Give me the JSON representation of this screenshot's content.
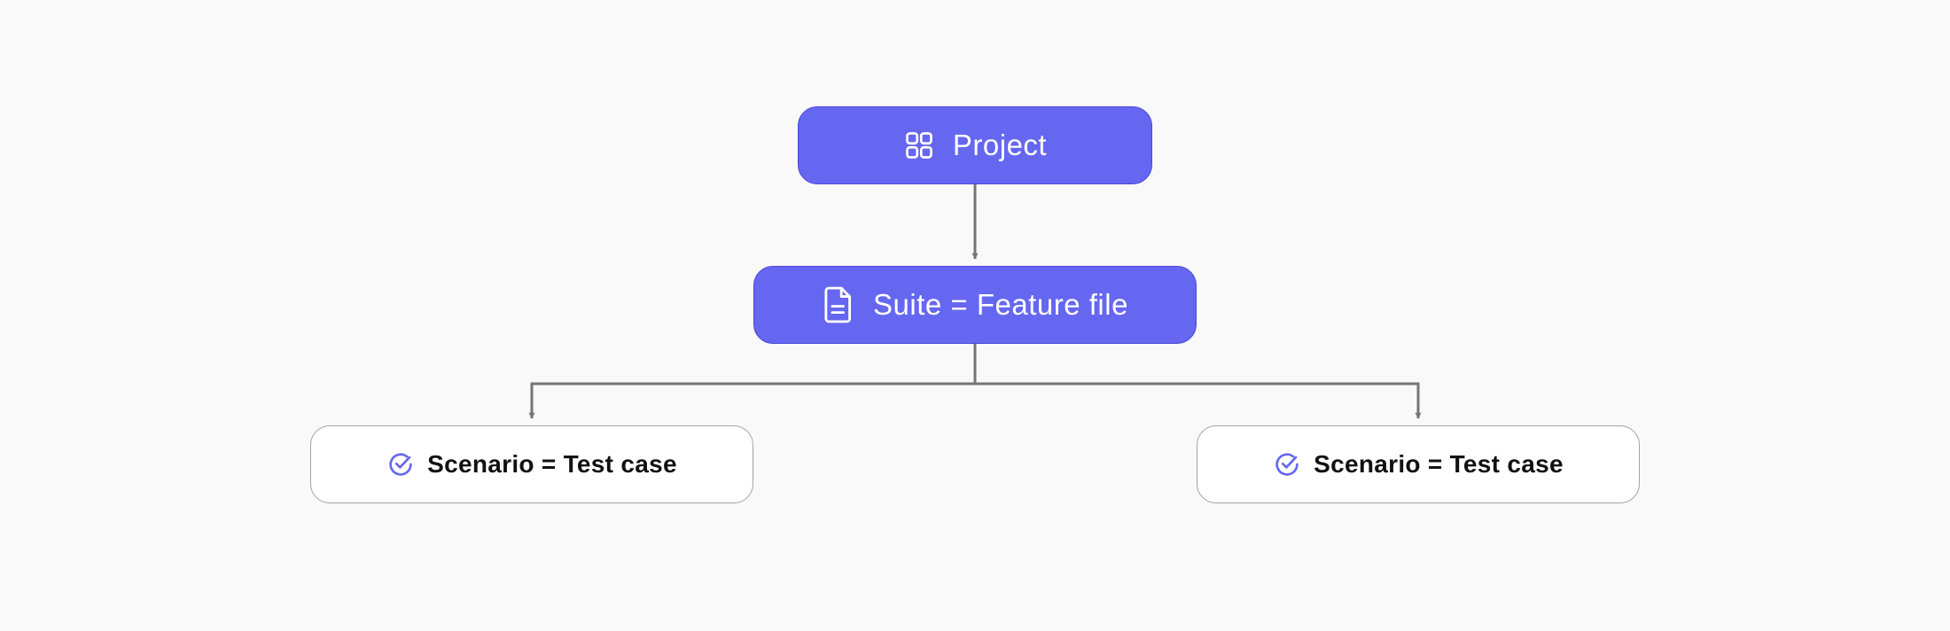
{
  "diagram": {
    "colors": {
      "background": "#f9f9f9",
      "primary_fill": "#6667f1",
      "primary_border": "#4b47d6",
      "secondary_fill": "#ffffff",
      "secondary_border": "#a3a3a3",
      "connector": "#757575",
      "check_icon": "#6667f1"
    },
    "nodes": [
      {
        "id": "project",
        "label": "Project",
        "icon": "grid-icon",
        "style": "primary"
      },
      {
        "id": "suite",
        "label": "Suite = Feature file",
        "icon": "document-icon",
        "style": "primary"
      },
      {
        "id": "scenario-1",
        "label": "Scenario = Test case",
        "icon": "check-circle-icon",
        "style": "secondary"
      },
      {
        "id": "scenario-2",
        "label": "Scenario = Test case",
        "icon": "check-circle-icon",
        "style": "secondary"
      }
    ],
    "edges": [
      {
        "from": "project",
        "to": "suite"
      },
      {
        "from": "suite",
        "to": "scenario-1"
      },
      {
        "from": "suite",
        "to": "scenario-2"
      }
    ]
  }
}
